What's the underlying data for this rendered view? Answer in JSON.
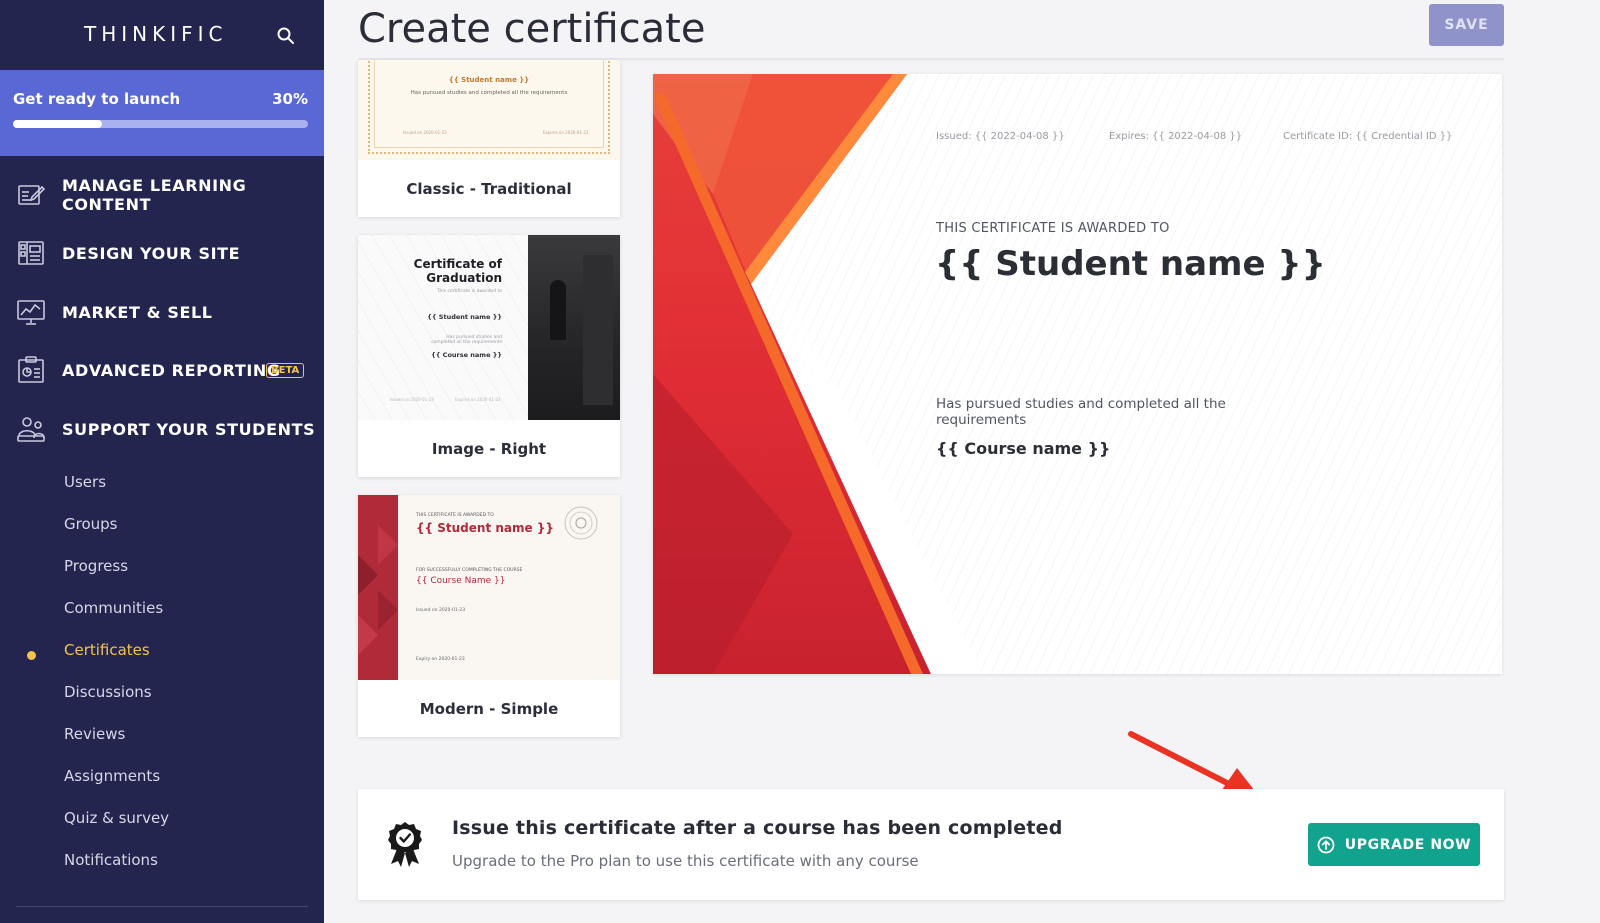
{
  "sidebar": {
    "brand": "THINKIFIC",
    "launch": {
      "title": "Get ready to launch",
      "percent_label": "30%",
      "progress": 0.3
    },
    "nav": [
      {
        "label": "MANAGE LEARNING CONTENT",
        "icon": "edit-content-icon"
      },
      {
        "label": "DESIGN YOUR SITE",
        "icon": "layout-icon"
      },
      {
        "label": "MARKET & SELL",
        "icon": "chart-board-icon"
      },
      {
        "label": "ADVANCED REPORTING",
        "icon": "report-icon",
        "badge": "BETA"
      },
      {
        "label": "SUPPORT YOUR STUDENTS",
        "icon": "students-icon"
      }
    ],
    "sub_items": [
      "Users",
      "Groups",
      "Progress",
      "Communities",
      "Certificates",
      "Discussions",
      "Reviews",
      "Assignments",
      "Quiz & survey",
      "Notifications"
    ],
    "active_sub_item": "Certificates"
  },
  "header": {
    "title": "Create certificate",
    "save_label": "SAVE"
  },
  "templates": [
    {
      "name": "Classic - Traditional",
      "student": "{{ Student name }}",
      "line": "Has pursued studies and completed all the requirements",
      "issued": "Issued on 2020-01-23",
      "expires": "Expires on 2020-01-23"
    },
    {
      "name": "Image - Right",
      "heading": "Certificate of Graduation",
      "awarded": "This certificate is awarded to",
      "student": "{{ Student name }}",
      "line": "Has pursued studies and completed all the requirements",
      "course": "{{ Course name }}",
      "issued": "Issued on 2020-01-23",
      "expires": "Expires on 2020-01-23"
    },
    {
      "name": "Modern - Simple",
      "awarded": "THIS CERTIFICATE IS AWARDED TO",
      "student": "{{ Student name }}",
      "line": "FOR SUCCESSFULLY COMPLETING THE COURSE",
      "course": "{{ Course Name }}",
      "issued": "Issued on 2020-01-23",
      "expires": "Expiry on 2020-01-23"
    }
  ],
  "preview": {
    "issued": "Issued: {{ 2022-04-08 }}",
    "expires": "Expires: {{ 2022-04-08 }}",
    "certificate_id": "Certificate ID: {{ Credential ID }}",
    "awarded": "THIS CERTIFICATE IS AWARDED TO",
    "student": "{{ Student name }}",
    "pursued": "Has pursued studies and completed all the requirements",
    "course": "{{ Course name }}"
  },
  "upgrade": {
    "title": "Issue this certificate after a course has been completed",
    "subtitle": "Upgrade to the Pro plan to use this certificate with any course",
    "button_label": "UPGRADE NOW",
    "button_color": "#11a38e"
  },
  "colors": {
    "sidebar_bg": "#24254f",
    "launch_bg": "#5968d4",
    "active": "#f5c34b",
    "cert_red": "#e02d35",
    "cert_orange": "#f56a2a",
    "arrow_red": "#ea3323"
  }
}
